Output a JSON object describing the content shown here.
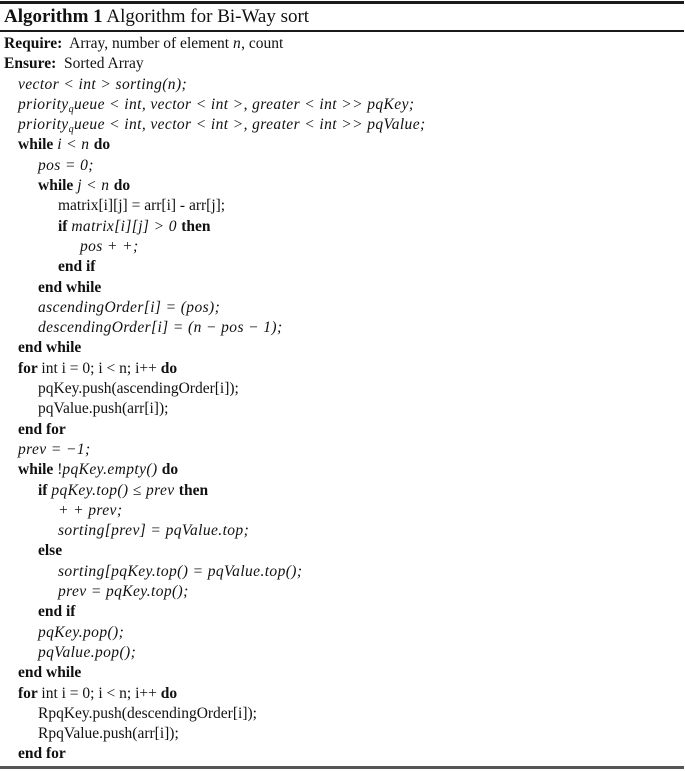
{
  "caption": {
    "label": "Algorithm 1",
    "title": "Algorithm for Bi-Way sort"
  },
  "lines": [
    {
      "indent": 0,
      "parts": [
        {
          "t": "kw",
          "v": "Require:"
        },
        {
          "t": "rm",
          "v": "  Array, number of element "
        },
        {
          "t": "it",
          "v": "n"
        },
        {
          "t": "rm",
          "v": ", count"
        }
      ],
      "header": true
    },
    {
      "indent": 0,
      "parts": [
        {
          "t": "kw",
          "v": "Ensure:"
        },
        {
          "t": "rm",
          "v": "  Sorted Array"
        }
      ],
      "header": true
    },
    {
      "indent": 1,
      "parts": [
        {
          "t": "it",
          "v": "vector < int > sorting(n);"
        }
      ]
    },
    {
      "indent": 1,
      "parts": [
        {
          "t": "it",
          "v": "priority"
        },
        {
          "t": "sub",
          "v": "q"
        },
        {
          "t": "it",
          "v": "ueue < int, vector < int >, greater < int >> pqKey;"
        }
      ]
    },
    {
      "indent": 1,
      "parts": [
        {
          "t": "it",
          "v": "priority"
        },
        {
          "t": "sub",
          "v": "q"
        },
        {
          "t": "it",
          "v": "ueue < int, vector < int >, greater < int >> pqValue;"
        }
      ]
    },
    {
      "indent": 1,
      "parts": [
        {
          "t": "kw",
          "v": "while "
        },
        {
          "t": "it",
          "v": "i < n "
        },
        {
          "t": "kw",
          "v": "do"
        }
      ]
    },
    {
      "indent": 2,
      "parts": [
        {
          "t": "it",
          "v": "pos = 0;"
        }
      ]
    },
    {
      "indent": 2,
      "parts": [
        {
          "t": "kw",
          "v": "while "
        },
        {
          "t": "it",
          "v": "j < n "
        },
        {
          "t": "kw",
          "v": "do"
        }
      ]
    },
    {
      "indent": 3,
      "parts": [
        {
          "t": "rm",
          "v": "matrix[i][j] = arr[i] - arr[j];"
        }
      ]
    },
    {
      "indent": 3,
      "parts": [
        {
          "t": "kw",
          "v": "if "
        },
        {
          "t": "it",
          "v": "matrix[i][j] > 0 "
        },
        {
          "t": "kw",
          "v": "then"
        }
      ]
    },
    {
      "indent": 4,
      "parts": [
        {
          "t": "it",
          "v": "pos + +;"
        }
      ]
    },
    {
      "indent": 3,
      "parts": [
        {
          "t": "kw",
          "v": "end if"
        }
      ]
    },
    {
      "indent": 2,
      "parts": [
        {
          "t": "kw",
          "v": "end while"
        }
      ]
    },
    {
      "indent": 2,
      "parts": [
        {
          "t": "it",
          "v": "ascendingOrder[i] = (pos);"
        }
      ]
    },
    {
      "indent": 2,
      "parts": [
        {
          "t": "it",
          "v": "descendingOrder[i] = (n − pos − 1);"
        }
      ]
    },
    {
      "indent": 1,
      "parts": [
        {
          "t": "kw",
          "v": "end while"
        }
      ]
    },
    {
      "indent": 1,
      "parts": [
        {
          "t": "kw",
          "v": "for "
        },
        {
          "t": "rm",
          "v": "int i = 0; i < n; i++ "
        },
        {
          "t": "kw",
          "v": "do"
        }
      ]
    },
    {
      "indent": 2,
      "parts": [
        {
          "t": "rm",
          "v": "pqKey.push(ascendingOrder[i]);"
        }
      ]
    },
    {
      "indent": 2,
      "parts": [
        {
          "t": "rm",
          "v": "pqValue.push(arr[i]);"
        }
      ]
    },
    {
      "indent": 1,
      "parts": [
        {
          "t": "kw",
          "v": "end for"
        }
      ]
    },
    {
      "indent": 1,
      "parts": [
        {
          "t": "it",
          "v": "prev = −1;"
        }
      ]
    },
    {
      "indent": 1,
      "parts": [
        {
          "t": "kw",
          "v": "while "
        },
        {
          "t": "rm",
          "v": "!"
        },
        {
          "t": "it",
          "v": "pqKey.empty() "
        },
        {
          "t": "kw",
          "v": "do"
        }
      ]
    },
    {
      "indent": 2,
      "parts": [
        {
          "t": "kw",
          "v": "if "
        },
        {
          "t": "it",
          "v": "pqKey.top() ≤ prev "
        },
        {
          "t": "kw",
          "v": "then"
        }
      ]
    },
    {
      "indent": 3,
      "parts": [
        {
          "t": "it",
          "v": "+ + prev;"
        }
      ]
    },
    {
      "indent": 3,
      "parts": [
        {
          "t": "it",
          "v": "sorting[prev] = pqValue.top;"
        }
      ]
    },
    {
      "indent": 2,
      "parts": [
        {
          "t": "kw",
          "v": "else"
        }
      ]
    },
    {
      "indent": 3,
      "parts": [
        {
          "t": "it",
          "v": "sorting[pqKey.top() = pqValue.top();"
        }
      ]
    },
    {
      "indent": 3,
      "parts": [
        {
          "t": "it",
          "v": "prev = pqKey.top();"
        }
      ]
    },
    {
      "indent": 2,
      "parts": [
        {
          "t": "kw",
          "v": "end if"
        }
      ]
    },
    {
      "indent": 2,
      "parts": [
        {
          "t": "it",
          "v": "pqKey.pop();"
        }
      ]
    },
    {
      "indent": 2,
      "parts": [
        {
          "t": "it",
          "v": "pqValue.pop();"
        }
      ]
    },
    {
      "indent": 1,
      "parts": [
        {
          "t": "kw",
          "v": "end while"
        }
      ]
    },
    {
      "indent": 1,
      "parts": [
        {
          "t": "kw",
          "v": "for "
        },
        {
          "t": "rm",
          "v": "int i = 0; i < n; i++ "
        },
        {
          "t": "kw",
          "v": "do"
        }
      ]
    },
    {
      "indent": 2,
      "parts": [
        {
          "t": "rm",
          "v": "RpqKey.push(descendingOrder[i]);"
        }
      ]
    },
    {
      "indent": 2,
      "parts": [
        {
          "t": "rm",
          "v": "RpqValue.push(arr[i]);"
        }
      ]
    },
    {
      "indent": 1,
      "parts": [
        {
          "t": "kw",
          "v": "end for"
        }
      ]
    }
  ]
}
